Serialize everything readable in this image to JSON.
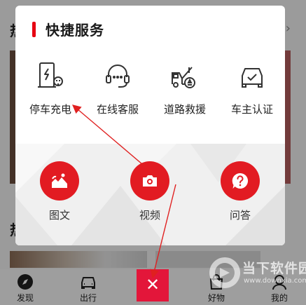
{
  "background": {
    "heading_1": "热",
    "heading_2": "热",
    "chevron": "›"
  },
  "popup": {
    "title": "快捷服务",
    "services": [
      {
        "label": "停车充电",
        "icon": "charging-station-icon"
      },
      {
        "label": "在线客服",
        "icon": "headset-icon"
      },
      {
        "label": "道路救援",
        "icon": "tow-truck-icon"
      },
      {
        "label": "车主认证",
        "icon": "car-verify-icon"
      }
    ],
    "actions": [
      {
        "label": "图文",
        "icon": "image-text-icon"
      },
      {
        "label": "视频",
        "icon": "camera-icon"
      },
      {
        "label": "问答",
        "icon": "question-icon"
      }
    ]
  },
  "tabbar": {
    "tabs": [
      {
        "label": "发现",
        "icon": "compass-icon"
      },
      {
        "label": "出行",
        "icon": "car-icon"
      },
      {
        "label": "好物",
        "icon": "shopping-bag-icon"
      },
      {
        "label": "我的",
        "icon": "user-icon"
      }
    ],
    "close_symbol": "✕"
  },
  "watermark": {
    "name": "当下软件园",
    "url": "www.downxia.com"
  },
  "colors": {
    "accent": "#e21b22",
    "close": "#e3163a"
  }
}
